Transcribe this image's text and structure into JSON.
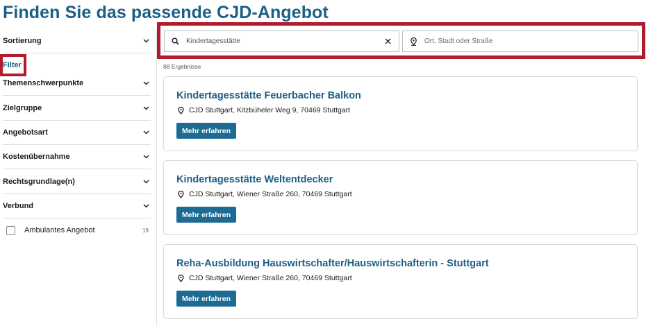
{
  "page": {
    "title": "Finden Sie das passende CJD-Angebot"
  },
  "sidebar": {
    "sort_label": "Sortierung",
    "filter_label": "Filter",
    "filters": [
      {
        "label": "Themenschwerpunkte"
      },
      {
        "label": "Zielgruppe"
      },
      {
        "label": "Angebotsart"
      },
      {
        "label": "Kostenübernahme"
      },
      {
        "label": "Rechtsgrundlage(n)"
      },
      {
        "label": "Verbund"
      }
    ],
    "options": [
      {
        "label": "Ambulantes Angebot",
        "count": "19",
        "checked": false
      }
    ]
  },
  "search": {
    "query_value": "Kindertagesstätte",
    "location_placeholder": "Ort, Stadt oder Straße"
  },
  "results": {
    "count_text": "88 Ergebnisse",
    "button_label": "Mehr erfahren",
    "items": [
      {
        "title": "Kindertagesstätte Feuerbacher Balkon",
        "address": "CJD Stuttgart, Kitzbüheler Weg 9, 70469 Stuttgart"
      },
      {
        "title": "Kindertagesstätte Weltentdecker",
        "address": "CJD Stuttgart, Wiener Straße 260, 70469 Stuttgart"
      },
      {
        "title": "Reha-Ausbildung Hauswirtschafter/Hauswirtschafterin - Stuttgart",
        "address": "CJD Stuttgart, Wiener Straße 260, 70469 Stuttgart"
      }
    ]
  },
  "colors": {
    "brand_blue": "#1b5f86",
    "button_blue": "#1d6a93",
    "highlight_red": "#b01c2e"
  },
  "icons": {
    "search": "search-icon",
    "clear": "close-icon",
    "location": "location-pin-icon",
    "address": "map-marker-icon",
    "expand": "chevron-down-icon"
  }
}
